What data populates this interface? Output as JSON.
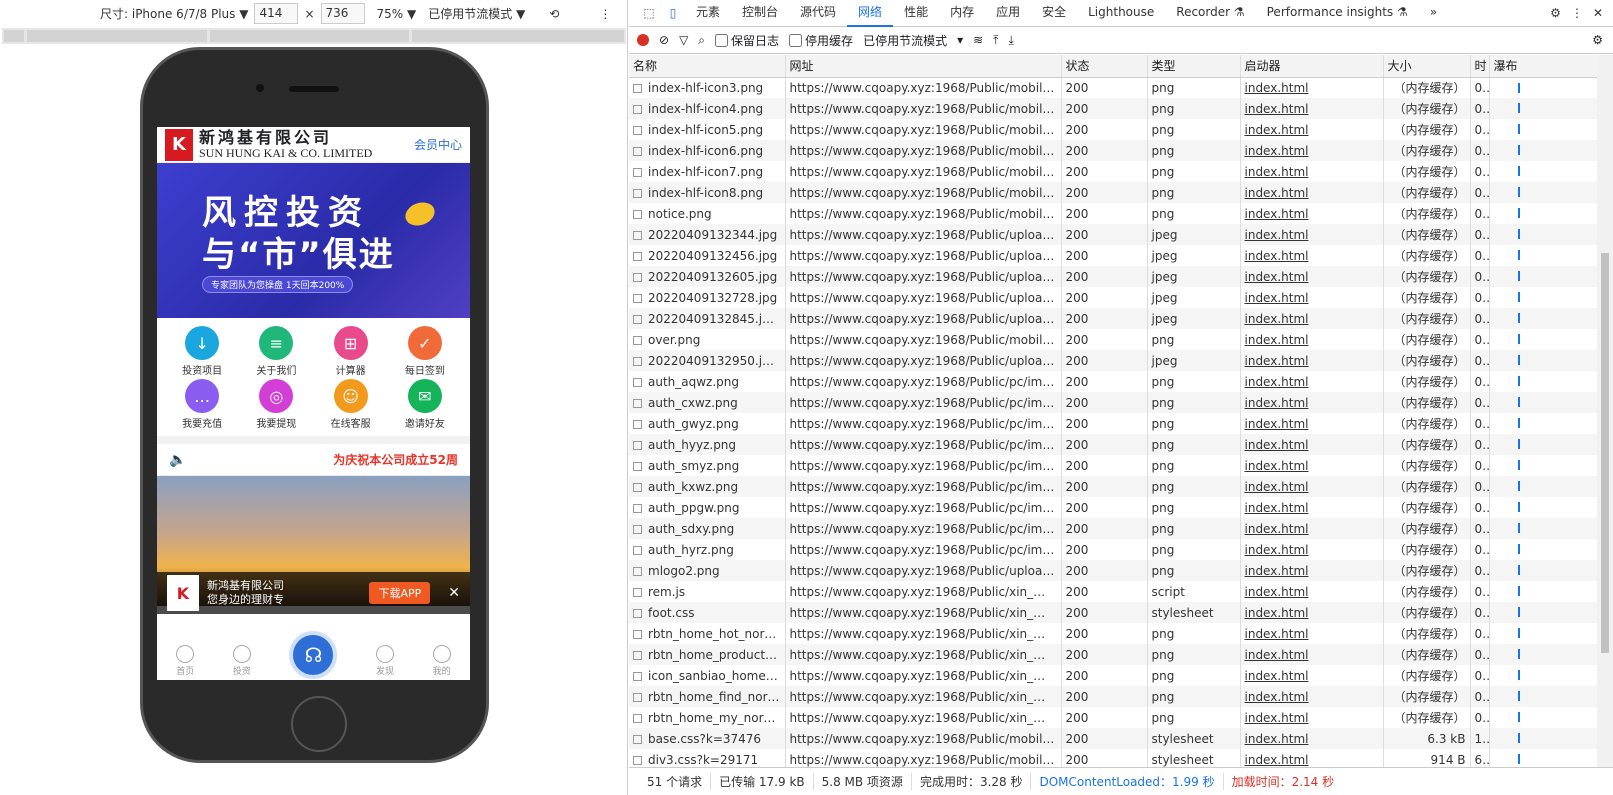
{
  "devtools_toolbar": {
    "size_label": "尺寸: iPhone 6/7/8 Plus ▼",
    "width": "414",
    "times": "×",
    "height": "736",
    "zoom": "75% ▼",
    "throttle": "已停用节流模式 ▼"
  },
  "mobile": {
    "company_cn": "新鸿基有限公司",
    "company_en": "SUN HUNG KAI & CO. LIMITED",
    "member": "会员中心",
    "banner_line1": "风控投资",
    "banner_line2": "与“市”俱进",
    "banner_sub": "专家团队为您操盘 1天回本200%",
    "icons": [
      {
        "label": "投资项目",
        "color": "#1aa7e0",
        "glyph": "↓"
      },
      {
        "label": "关于我们",
        "color": "#1fb87a",
        "glyph": "≡"
      },
      {
        "label": "计算器",
        "color": "#e94a8c",
        "glyph": "⊞"
      },
      {
        "label": "每日签到",
        "color": "#f06a3a",
        "glyph": "✓"
      },
      {
        "label": "我要充值",
        "color": "#8b5cf0",
        "glyph": "…"
      },
      {
        "label": "我要提现",
        "color": "#d33ed6",
        "glyph": "◎"
      },
      {
        "label": "在线客服",
        "color": "#f39a1c",
        "glyph": "☺"
      },
      {
        "label": "邀请好友",
        "color": "#15b35a",
        "glyph": "✉"
      }
    ],
    "notice": "为庆祝本公司成立52周",
    "app_title": "新鸿基有限公司",
    "app_sub": "您身边的理财专",
    "download": "下载APP",
    "close": "✕",
    "tabs": [
      "首页",
      "投资",
      "",
      "发现",
      "我的"
    ]
  },
  "devtools": {
    "panel_tabs": [
      "元素",
      "控制台",
      "源代码",
      "网络",
      "性能",
      "内存",
      "应用",
      "安全",
      "Lighthouse",
      "Recorder ⚗",
      "Performance insights ⚗",
      "»"
    ],
    "active_tab": "网络",
    "preserve_log": "保留日志",
    "disable_cache": "停用缓存",
    "throttle": "已停用节流模式",
    "columns": [
      "名称",
      "网址",
      "状态",
      "类型",
      "启动器",
      "大小",
      "时",
      "瀑布"
    ],
    "rows": [
      {
        "name": "index-hlf-icon3.png",
        "url": "https://www.cqoapy.xyz:1968/Public/mobile/img/i...",
        "status": "200",
        "type": "png",
        "init": "index.html",
        "size": "（内存缓存）",
        "time": "0..."
      },
      {
        "name": "index-hlf-icon4.png",
        "url": "https://www.cqoapy.xyz:1968/Public/mobile/img/i...",
        "status": "200",
        "type": "png",
        "init": "index.html",
        "size": "（内存缓存）",
        "time": "0..."
      },
      {
        "name": "index-hlf-icon5.png",
        "url": "https://www.cqoapy.xyz:1968/Public/mobile/img/i...",
        "status": "200",
        "type": "png",
        "init": "index.html",
        "size": "（内存缓存）",
        "time": "0..."
      },
      {
        "name": "index-hlf-icon6.png",
        "url": "https://www.cqoapy.xyz:1968/Public/mobile/img/i...",
        "status": "200",
        "type": "png",
        "init": "index.html",
        "size": "（内存缓存）",
        "time": "0..."
      },
      {
        "name": "index-hlf-icon7.png",
        "url": "https://www.cqoapy.xyz:1968/Public/mobile/img/i...",
        "status": "200",
        "type": "png",
        "init": "index.html",
        "size": "（内存缓存）",
        "time": "0..."
      },
      {
        "name": "index-hlf-icon8.png",
        "url": "https://www.cqoapy.xyz:1968/Public/mobile/img/i...",
        "status": "200",
        "type": "png",
        "init": "index.html",
        "size": "（内存缓存）",
        "time": "0..."
      },
      {
        "name": "notice.png",
        "url": "https://www.cqoapy.xyz:1968/Public/mobile/img/...",
        "status": "200",
        "type": "png",
        "init": "index.html",
        "size": "（内存缓存）",
        "time": "0..."
      },
      {
        "name": "20220409132344.jpg",
        "url": "https://www.cqoapy.xyz:1968/Public/uploads/item...",
        "status": "200",
        "type": "jpeg",
        "init": "index.html",
        "size": "（内存缓存）",
        "time": "0..."
      },
      {
        "name": "20220409132456.jpg",
        "url": "https://www.cqoapy.xyz:1968/Public/uploads/item...",
        "status": "200",
        "type": "jpeg",
        "init": "index.html",
        "size": "（内存缓存）",
        "time": "0..."
      },
      {
        "name": "20220409132605.jpg",
        "url": "https://www.cqoapy.xyz:1968/Public/uploads/item...",
        "status": "200",
        "type": "jpeg",
        "init": "index.html",
        "size": "（内存缓存）",
        "time": "0..."
      },
      {
        "name": "20220409132728.jpg",
        "url": "https://www.cqoapy.xyz:1968/Public/uploads/item...",
        "status": "200",
        "type": "jpeg",
        "init": "index.html",
        "size": "（内存缓存）",
        "time": "0..."
      },
      {
        "name": "20220409132845.jpeg",
        "url": "https://www.cqoapy.xyz:1968/Public/uploads/item...",
        "status": "200",
        "type": "jpeg",
        "init": "index.html",
        "size": "（内存缓存）",
        "time": "0..."
      },
      {
        "name": "over.png",
        "url": "https://www.cqoapy.xyz:1968/Public/mobile/img/...",
        "status": "200",
        "type": "png",
        "init": "index.html",
        "size": "（内存缓存）",
        "time": "0..."
      },
      {
        "name": "20220409132950.jpeg",
        "url": "https://www.cqoapy.xyz:1968/Public/uploads/item...",
        "status": "200",
        "type": "jpeg",
        "init": "index.html",
        "size": "（内存缓存）",
        "time": "0..."
      },
      {
        "name": "auth_aqwz.png",
        "url": "https://www.cqoapy.xyz:1968/Public/pc/img/auth_...",
        "status": "200",
        "type": "png",
        "init": "index.html",
        "size": "（内存缓存）",
        "time": "0..."
      },
      {
        "name": "auth_cxwz.png",
        "url": "https://www.cqoapy.xyz:1968/Public/pc/img/auth_...",
        "status": "200",
        "type": "png",
        "init": "index.html",
        "size": "（内存缓存）",
        "time": "0..."
      },
      {
        "name": "auth_gwyz.png",
        "url": "https://www.cqoapy.xyz:1968/Public/pc/img/auth_...",
        "status": "200",
        "type": "png",
        "init": "index.html",
        "size": "（内存缓存）",
        "time": "0..."
      },
      {
        "name": "auth_hyyz.png",
        "url": "https://www.cqoapy.xyz:1968/Public/pc/img/auth_...",
        "status": "200",
        "type": "png",
        "init": "index.html",
        "size": "（内存缓存）",
        "time": "0..."
      },
      {
        "name": "auth_smyz.png",
        "url": "https://www.cqoapy.xyz:1968/Public/pc/img/auth_...",
        "status": "200",
        "type": "png",
        "init": "index.html",
        "size": "（内存缓存）",
        "time": "0..."
      },
      {
        "name": "auth_kxwz.png",
        "url": "https://www.cqoapy.xyz:1968/Public/pc/img/auth_...",
        "status": "200",
        "type": "png",
        "init": "index.html",
        "size": "（内存缓存）",
        "time": "0..."
      },
      {
        "name": "auth_ppgw.png",
        "url": "https://www.cqoapy.xyz:1968/Public/pc/img/auth_...",
        "status": "200",
        "type": "png",
        "init": "index.html",
        "size": "（内存缓存）",
        "time": "0..."
      },
      {
        "name": "auth_sdxy.png",
        "url": "https://www.cqoapy.xyz:1968/Public/pc/img/auth_...",
        "status": "200",
        "type": "png",
        "init": "index.html",
        "size": "（内存缓存）",
        "time": "0..."
      },
      {
        "name": "auth_hyrz.png",
        "url": "https://www.cqoapy.xyz:1968/Public/pc/img/auth_...",
        "status": "200",
        "type": "png",
        "init": "index.html",
        "size": "（内存缓存）",
        "time": "0..."
      },
      {
        "name": "mlogo2.png",
        "url": "https://www.cqoapy.xyz:1968/Public/uploads/mlo...",
        "status": "200",
        "type": "png",
        "init": "index.html",
        "size": "（内存缓存）",
        "time": "0..."
      },
      {
        "name": "rem.js",
        "url": "https://www.cqoapy.xyz:1968/Public/xin_mobile/st...",
        "status": "200",
        "type": "script",
        "init": "index.html",
        "size": "（内存缓存）",
        "time": "0..."
      },
      {
        "name": "foot.css",
        "url": "https://www.cqoapy.xyz:1968/Public/xin_mobile/st...",
        "status": "200",
        "type": "stylesheet",
        "init": "index.html",
        "size": "（内存缓存）",
        "time": "0..."
      },
      {
        "name": "rbtn_home_hot_norma...",
        "url": "https://www.cqoapy.xyz:1968/Public/xin_mobile/st...",
        "status": "200",
        "type": "png",
        "init": "index.html",
        "size": "（内存缓存）",
        "time": "0..."
      },
      {
        "name": "rbtn_home_product_ch...",
        "url": "https://www.cqoapy.xyz:1968/Public/xin_mobile/st...",
        "status": "200",
        "type": "png",
        "init": "index.html",
        "size": "（内存缓存）",
        "time": "0..."
      },
      {
        "name": "icon_sanbiao_home.png",
        "url": "https://www.cqoapy.xyz:1968/Public/xin_mobile/st...",
        "status": "200",
        "type": "png",
        "init": "index.html",
        "size": "（内存缓存）",
        "time": "0..."
      },
      {
        "name": "rbtn_home_find_norm...",
        "url": "https://www.cqoapy.xyz:1968/Public/xin_mobile/st...",
        "status": "200",
        "type": "png",
        "init": "index.html",
        "size": "（内存缓存）",
        "time": "0..."
      },
      {
        "name": "rbtn_home_my_normal...",
        "url": "https://www.cqoapy.xyz:1968/Public/xin_mobile/st...",
        "status": "200",
        "type": "png",
        "init": "index.html",
        "size": "（内存缓存）",
        "time": "0..."
      },
      {
        "name": "base.css?k=37476",
        "url": "https://www.cqoapy.xyz:1968/Public/mobile/css/b...",
        "status": "200",
        "type": "stylesheet",
        "init": "index.html",
        "size": "6.3 kB",
        "time": "1..."
      },
      {
        "name": "div3.css?k=29171",
        "url": "https://www.cqoapy.xyz:1968/Public/mobile/css/d...",
        "status": "200",
        "type": "stylesheet",
        "init": "index.html",
        "size": "914 B",
        "time": "6..."
      }
    ],
    "status_bar": {
      "requests": "51 个请求",
      "transferred": "已传输 17.9 kB",
      "resources": "5.8 MB 项资源",
      "finish": "完成用时：3.28 秒",
      "dcl": "DOMContentLoaded：1.99 秒",
      "load": "加载时间：2.14 秒"
    }
  }
}
